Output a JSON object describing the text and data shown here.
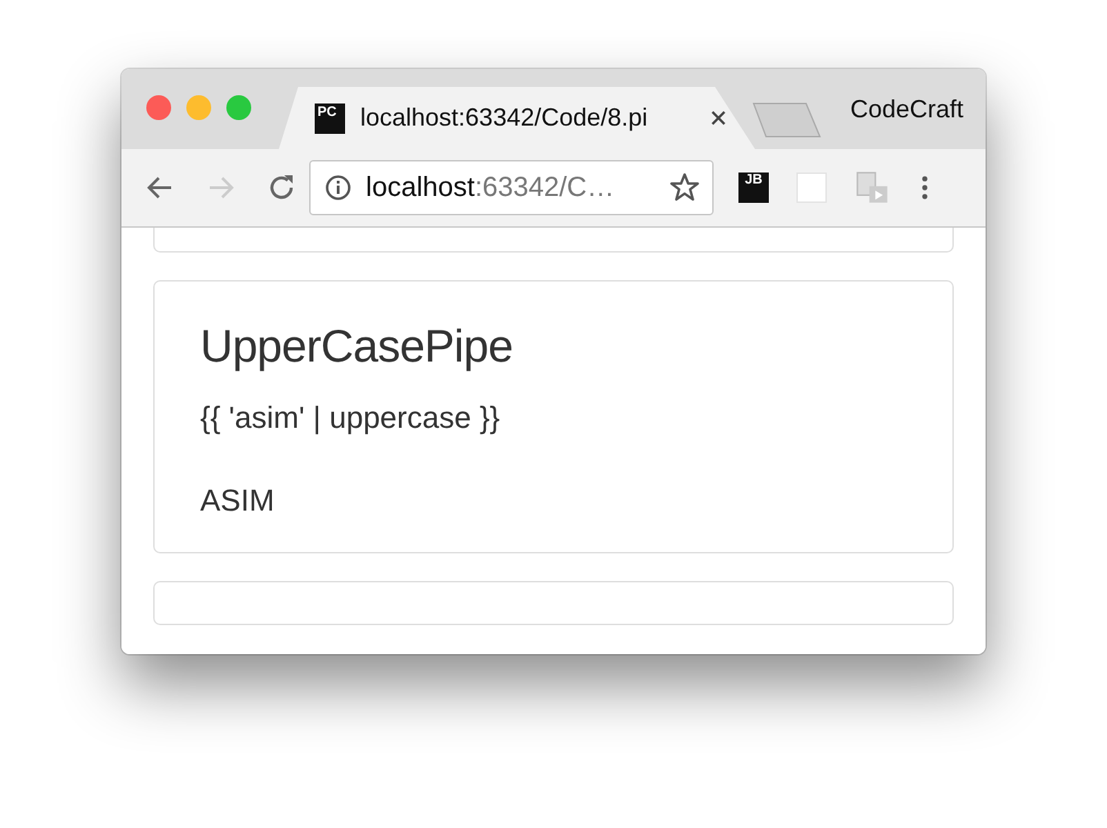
{
  "window": {
    "tab": {
      "favicon": "PC",
      "title": "localhost:63342/Code/8.pi",
      "selected": true
    },
    "profile": "CodeCraft",
    "nav_buttons": [
      {
        "kind": "back",
        "disabled": false
      },
      {
        "kind": "forward",
        "disabled": true
      },
      {
        "kind": "reload",
        "disabled": false
      }
    ],
    "address_bar": {
      "host": "localhost",
      "path": ":63342/C…"
    },
    "extensions": [
      {
        "kind": "jb",
        "label": "JB"
      },
      {
        "kind": "blank"
      },
      {
        "kind": "media"
      }
    ]
  },
  "cards": [
    {
      "kind": "partial"
    },
    {
      "kind": "pipe",
      "title": "UpperCasePipe",
      "code": "{{ 'asim' | uppercase }}",
      "output": "ASIM"
    },
    {
      "kind": "partial"
    }
  ]
}
